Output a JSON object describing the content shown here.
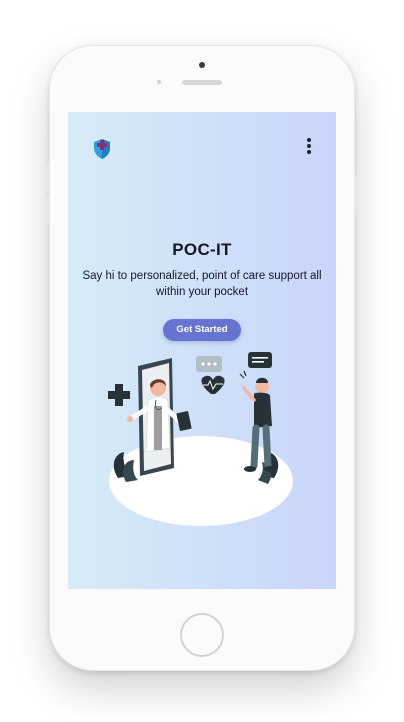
{
  "app": {
    "title": "POC-IT",
    "subtitle": "Say hi to personalized, point of care support all within your pocket",
    "cta_label": "Get Started"
  },
  "icons": {
    "logo": "shield-cross-icon",
    "menu": "more-vertical-icon"
  },
  "colors": {
    "cta": "#6773d3",
    "title": "#15172c",
    "screen_gradient_start": "#d6ecf6",
    "screen_gradient_end": "#c9d5fb",
    "logo_shield": "#2aa3e0",
    "logo_cross": "#8a2c7a"
  }
}
